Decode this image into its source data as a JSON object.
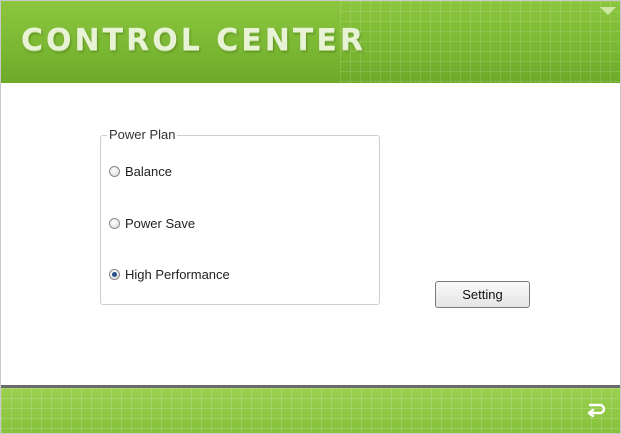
{
  "app": {
    "title": "CONTROL CENTER"
  },
  "power_plan": {
    "legend": "Power Plan",
    "options": [
      {
        "label": "Balance",
        "selected": false
      },
      {
        "label": "Power Save",
        "selected": false
      },
      {
        "label": "High Performance",
        "selected": true
      }
    ]
  },
  "actions": {
    "setting_label": "Setting"
  },
  "icons": {
    "menu": "menu-arrow-icon",
    "back": "back-arrow-icon"
  },
  "colors": {
    "accent_green": "#7bb833",
    "footer_green": "#8cc63f",
    "divider": "#6a6a6a"
  }
}
